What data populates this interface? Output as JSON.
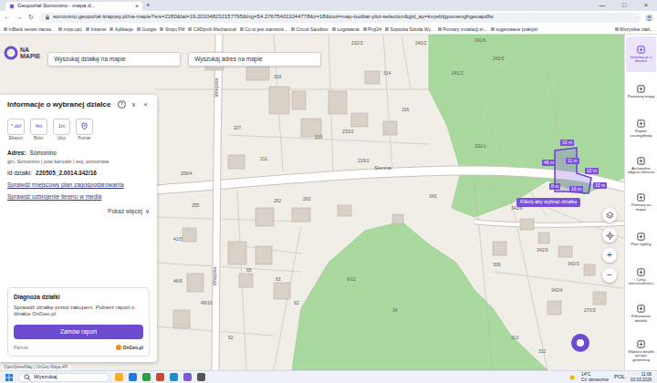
{
  "browser": {
    "tab_title": "Geoportal Somonino - mapa d...",
    "tab_close": "×",
    "new_tab": "+",
    "window_controls": [
      "—",
      "□",
      "×"
    ],
    "nav": [
      "←",
      "→",
      "↻"
    ],
    "address": "somonino.geoportal-krajowy.pl/na-mapie?srs=2180&lat=19.201048232157795&lng=54.276754011044778&z=18&tool=map-toolbar-plot-selection&gid_ap=kvyebfgpumenghgeoapdfw",
    "bookmarks": [
      "mBank serwis transa...",
      "moje.upc",
      "Intranet",
      "Aplikacje",
      "Google",
      "Sinpu FM",
      "CADprofi Mechanical",
      "Co to jest starosink...",
      "Circuit Sandbox",
      "Logowania",
      "Pinji24",
      "Sopocka Szkoła Wy...",
      "Pomiary instalacji el...",
      "sugerowane praktyki"
    ],
    "all_bookmarks": "Wszystkie zakł..."
  },
  "header": {
    "logo_lines": [
      "NA",
      "MAPIE"
    ],
    "search_plot": "Wyszukaj działkę na mapie",
    "search_address": "Wyszukaj adres na mapie"
  },
  "panel": {
    "title": "Informacje o wybranej działce",
    "help": "?",
    "collapse": "∨",
    "close": "×",
    "tools": [
      {
        "kind": "text",
        "glyph": "*.dxf",
        "label": "Eksport"
      },
      {
        "kind": "text",
        "glyph": "4m",
        "label": "Bufor"
      },
      {
        "kind": "text",
        "glyph": "1m",
        "label": "Ulicy"
      },
      {
        "kind": "pin",
        "label": "Pomiar"
      }
    ],
    "address_label": "Adres:",
    "address": "Somonino",
    "admin": "gm. Somonino | pow kartuski | woj. pomorskie",
    "id_label": "Id działki:",
    "id": "220505_2.0014.342/16",
    "links": [
      "Sprawdź miejscowy plan zagospodarowania",
      "Sprawdź uzbrojenie terenu w media"
    ],
    "more": "Pokaż więcej",
    "more_icon": "∨"
  },
  "diagnosis": {
    "title": "Diagnoza działki",
    "text": "Sprawdź działkę przed zakupem. Pobierz raport o działce OnGeo.pl",
    "button": "Zamów raport",
    "partner": "Partner",
    "brand": "OnGeo.pl"
  },
  "map": {
    "street_labels": [
      "Sienna",
      "Wiejska",
      "Wiejska"
    ],
    "parcels": [
      "232/3",
      "240/2",
      "242/6",
      "242/5",
      "241/2",
      "233/2",
      "219",
      "216/2",
      "211",
      "207",
      "256/4",
      "255",
      "262",
      "263",
      "41/5",
      "46/6",
      "49/10",
      "65",
      "63",
      "62",
      "52",
      "6/12",
      "34",
      "343",
      "342/8",
      "342/9",
      "342/3",
      "342/4",
      "308",
      "270/3",
      "313",
      "312",
      "314",
      "315",
      "318",
      "332/1"
    ],
    "measurements": [
      "33 m",
      "46 m",
      "11 m",
      "22 m",
      "15 m",
      "8 m",
      "16 m"
    ],
    "tooltip": "Kliknij aby wybrać działkę",
    "controls": [
      "+",
      "−"
    ],
    "attribution": "OpenStreetMap | OnGeo Mapa API"
  },
  "sidebar": [
    {
      "label": "Informacje o działce",
      "selected": true
    },
    {
      "label": "Porównaj mapy",
      "selected": false
    },
    {
      "label": "Raport szczegółowy",
      "selected": false
    },
    {
      "label": "Archiwalne zdjęcia lotnicze",
      "selected": false
    },
    {
      "label": "Pomiary na mapie",
      "selected": false
    },
    {
      "label": "Plan ogólny",
      "selected": false
    },
    {
      "label": "Ceny nieruchomości",
      "selected": false
    },
    {
      "label": "Filtrowanie działek",
      "selected": false
    },
    {
      "label": "Wybierz działki rysując geometrię",
      "selected": false
    }
  ],
  "taskbar": {
    "search": "Wyszukaj",
    "weather_temp": "14°C",
    "weather_text": "Cz. słonecznie",
    "language": "POL",
    "time": "11:06",
    "date": "03.03.2026"
  }
}
